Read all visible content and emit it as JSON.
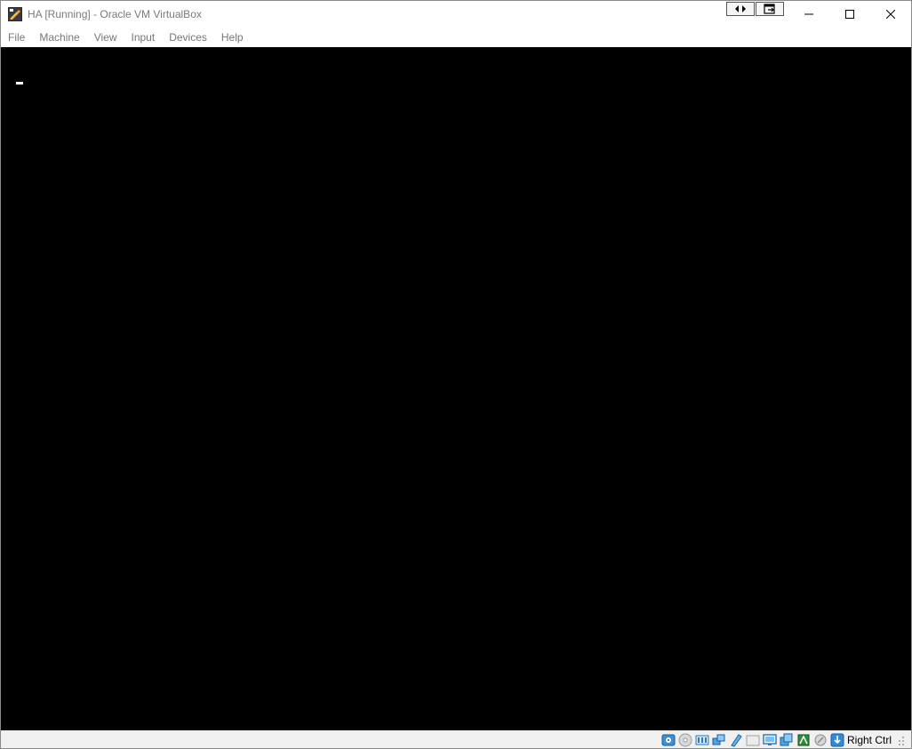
{
  "window": {
    "title": "HA [Running] - Oracle VM VirtualBox"
  },
  "menu": {
    "items": [
      "File",
      "Machine",
      "View",
      "Input",
      "Devices",
      "Help"
    ]
  },
  "statusbar": {
    "host_key": "Right Ctrl",
    "indicators": [
      "hard-disk-icon",
      "optical-drive-icon",
      "audio-icon",
      "network-icon",
      "usb-icon",
      "shared-folders-icon",
      "display-icon",
      "video-capture-icon",
      "cpu-icon",
      "mouse-integration-icon",
      "keyboard-icon"
    ]
  }
}
